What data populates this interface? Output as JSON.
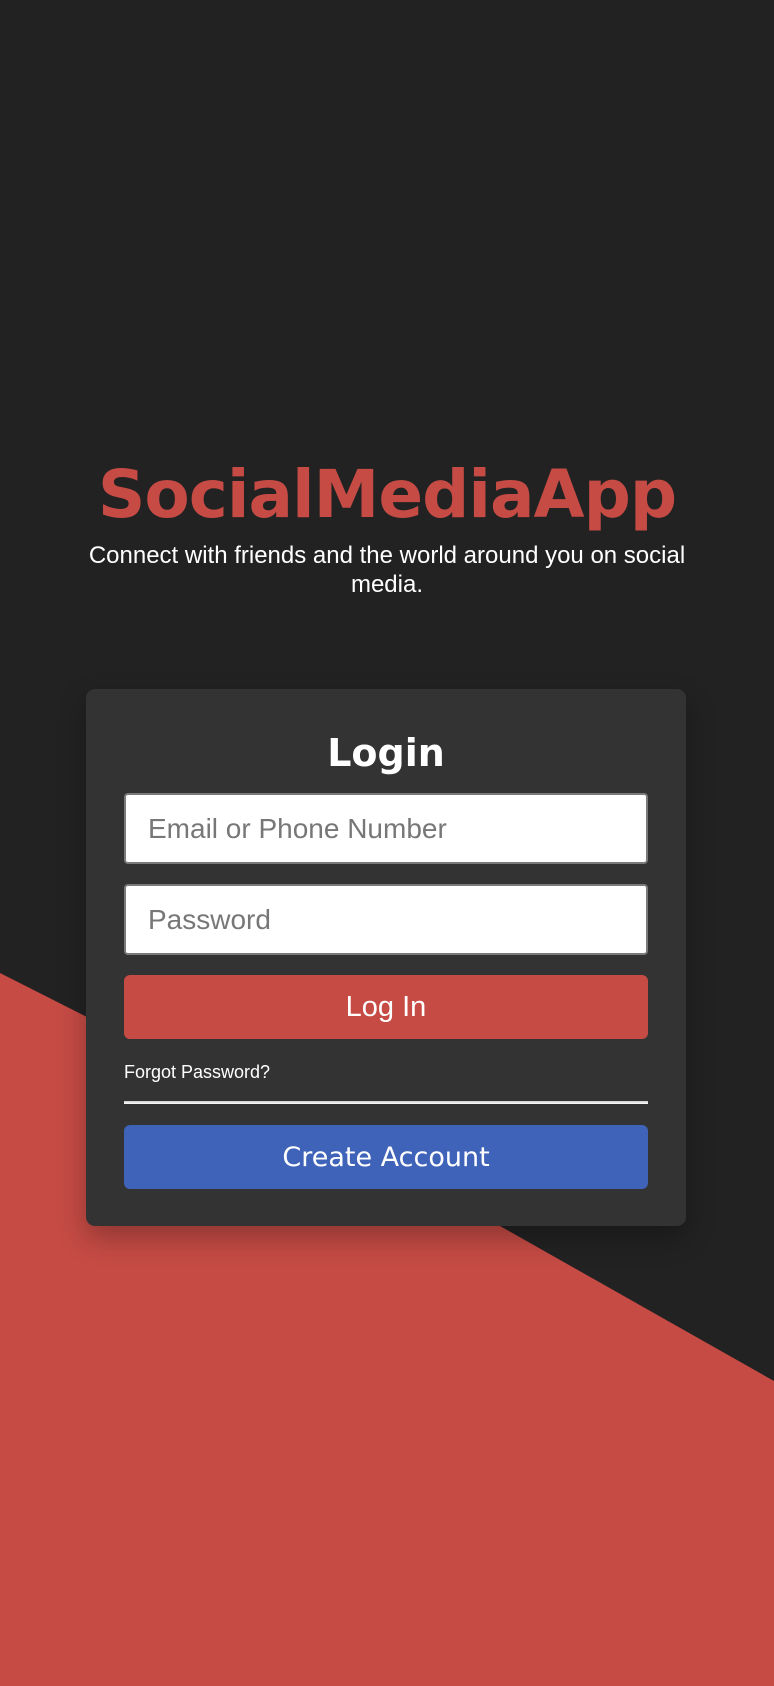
{
  "app": {
    "brand_name": "SocialMediaApp",
    "tagline": "Connect with friends and the world around you on social media."
  },
  "login_form": {
    "title": "Login",
    "email_placeholder": "Email or Phone Number",
    "password_placeholder": "Password",
    "login_label": "Log In",
    "forgot_label": "Forgot Password?",
    "create_account_label": "Create Account"
  },
  "colors": {
    "background_dark": "#222222",
    "card_bg": "#333333",
    "brand_red": "#c64b45",
    "login_button": "#c64b45",
    "create_button": "#3f63b8",
    "text": "#ffffff"
  }
}
